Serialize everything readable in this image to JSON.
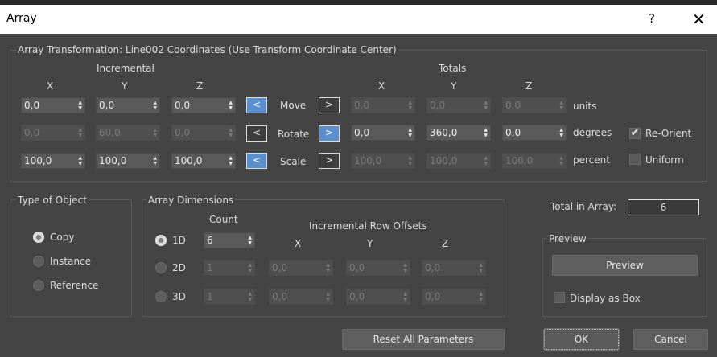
{
  "window": {
    "title": "Array",
    "help_glyph": "?",
    "close_glyph": "✕"
  },
  "transform": {
    "group_title": "Array Transformation: Line002 Coordinates (Use Transform Coordinate Center)",
    "incremental_label": "Incremental",
    "totals_label": "Totals",
    "axes": {
      "x": "X",
      "y": "Y",
      "z": "Z"
    },
    "move": {
      "label": "Move",
      "units": "units",
      "inc": [
        "0,0",
        "0,0",
        "0,0"
      ],
      "tot": [
        "0,0",
        "0,0",
        "0,0"
      ],
      "left_arrow": "<",
      "right_arrow": ">"
    },
    "rotate": {
      "label": "Rotate",
      "units": "degrees",
      "inc": [
        "0,0",
        "60,0",
        "0,0"
      ],
      "tot": [
        "0,0",
        "360,0",
        "0,0"
      ],
      "left_arrow": "<",
      "right_arrow": ">"
    },
    "scale": {
      "label": "Scale",
      "units": "percent",
      "inc": [
        "100,0",
        "100,0",
        "100,0"
      ],
      "tot": [
        "100,0",
        "100,0",
        "100,0"
      ],
      "left_arrow": "<",
      "right_arrow": ">"
    },
    "reorient": {
      "label": "Re-Orient",
      "checked": true,
      "check_glyph": "✔"
    },
    "uniform": {
      "label": "Uniform",
      "checked": false
    }
  },
  "type_of_object": {
    "title": "Type of Object",
    "options": [
      "Copy",
      "Instance",
      "Reference"
    ],
    "selected": "Copy"
  },
  "array_dimensions": {
    "title": "Array Dimensions",
    "count_label": "Count",
    "offsets_label": "Incremental Row Offsets",
    "axes": {
      "x": "X",
      "y": "Y",
      "z": "Z"
    },
    "d1": {
      "label": "1D",
      "count": "6"
    },
    "d2": {
      "label": "2D",
      "count": "1",
      "offsets": [
        "0,0",
        "0,0",
        "0,0"
      ]
    },
    "d3": {
      "label": "3D",
      "count": "1",
      "offsets": [
        "0,0",
        "0,0",
        "0,0"
      ]
    },
    "selected": "1D"
  },
  "total": {
    "label": "Total in Array:",
    "value": "6"
  },
  "preview": {
    "title": "Preview",
    "button": "Preview",
    "display_as_box": "Display as Box"
  },
  "buttons": {
    "reset": "Reset All Parameters",
    "ok": "OK",
    "cancel": "Cancel"
  }
}
